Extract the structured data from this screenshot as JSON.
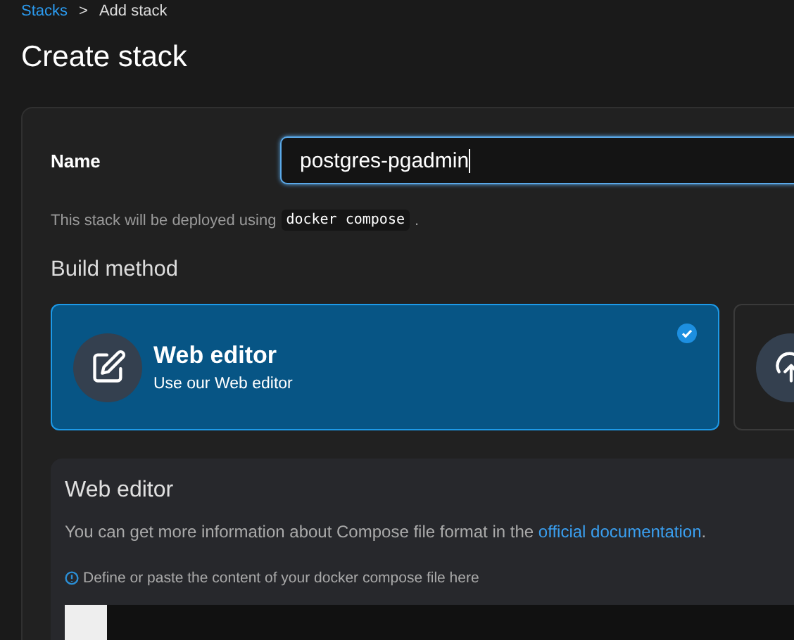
{
  "breadcrumb": {
    "link": "Stacks",
    "separator": ">",
    "current": "Add stack"
  },
  "title": "Create stack",
  "name_field": {
    "label": "Name",
    "value": "postgres-pgadmin"
  },
  "deploy_hint": {
    "text": "This stack will be deployed using",
    "code": "docker compose",
    "end": "."
  },
  "build_method": {
    "heading": "Build method",
    "options": [
      {
        "kind": "editor",
        "title": "Web editor",
        "subtitle": "Use our Web editor",
        "selected": true
      },
      {
        "kind": "upload",
        "selected": false
      }
    ]
  },
  "editor_section": {
    "heading": "Web editor",
    "text": "You can get more information about Compose file format in the",
    "link": "official documentation",
    "end": ".",
    "info": "Define or paste the content of your docker compose file here"
  }
}
